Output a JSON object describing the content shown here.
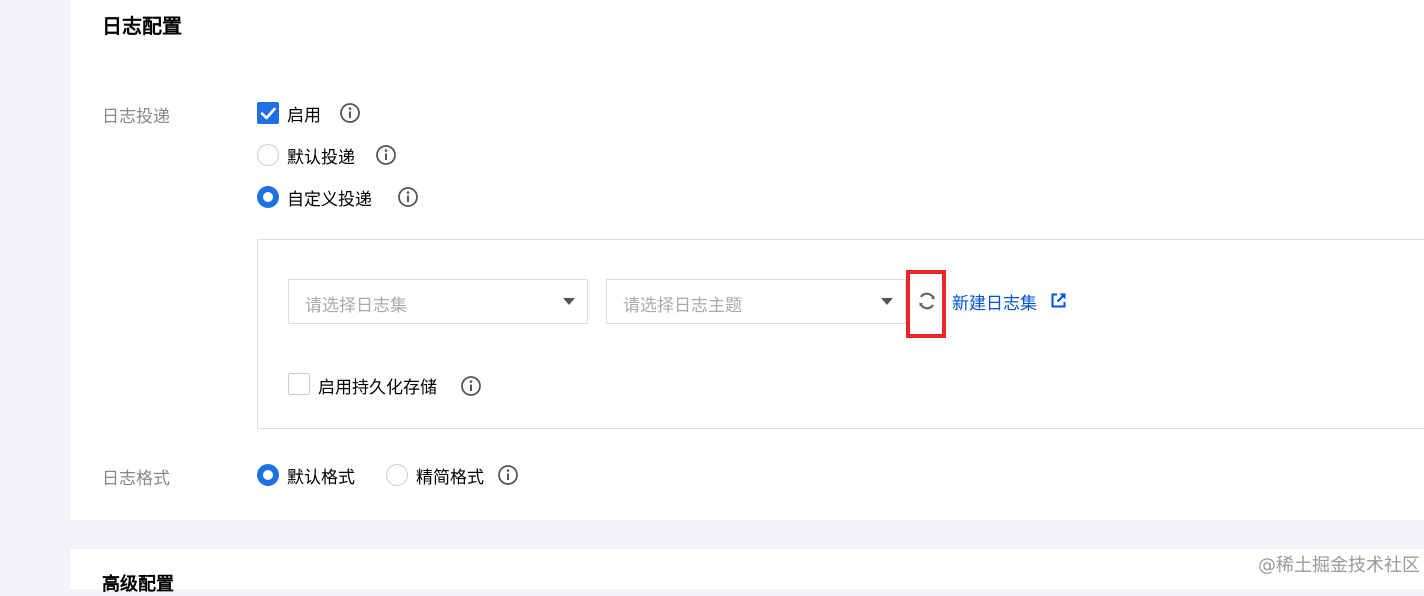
{
  "log_config": {
    "title": "日志配置",
    "delivery": {
      "label": "日志投递",
      "enable_label": "启用",
      "enable_checked": true,
      "default_delivery_label": "默认投递",
      "custom_delivery_label": "自定义投递",
      "selected_mode": "custom",
      "logset_placeholder": "请选择日志集",
      "topic_placeholder": "请选择日志主题",
      "new_logset_link": "新建日志集",
      "persistent_storage_label": "启用持久化存储",
      "persistent_storage_checked": false
    },
    "format": {
      "label": "日志格式",
      "default_format_label": "默认格式",
      "simple_format_label": "精简格式",
      "selected": "default"
    }
  },
  "next_section": {
    "title": "高级配置"
  },
  "watermark": "@稀土掘金技术社区",
  "icons": {
    "info": "info-circle-icon",
    "refresh": "refresh-icon",
    "external": "external-link-icon",
    "dropdown": "chevron-down-icon"
  },
  "colors": {
    "accent": "#1f6fe5",
    "link": "#0052d9",
    "highlight": "#e7252c",
    "label_gray": "#888888"
  }
}
